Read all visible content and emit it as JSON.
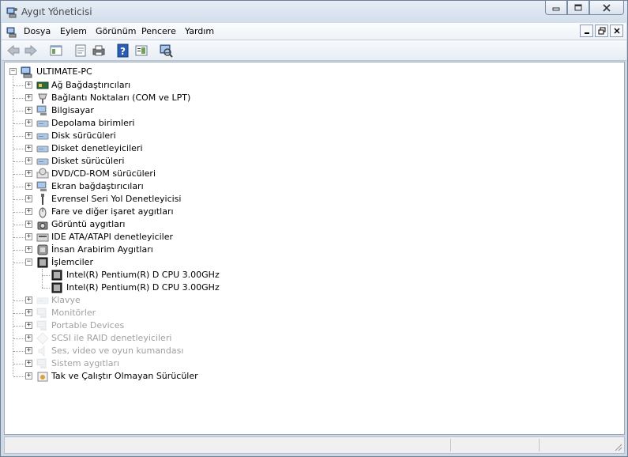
{
  "window": {
    "title": "Aygıt Yöneticisi"
  },
  "menu": [
    "Dosya",
    "Eylem",
    "Görünüm",
    "Pencere",
    "Yardım"
  ],
  "toolbar_icons": [
    "back-icon",
    "forward-icon",
    "show-hide-tree-icon",
    "properties-icon",
    "print-icon",
    "help-icon",
    "view-icon",
    "scan-hardware-icon"
  ],
  "tree": {
    "root": "ULTIMATE-PC",
    "categories": [
      {
        "label": "Ağ Bağdaştırıcıları",
        "icon": "network-adapter-icon",
        "dim": false
      },
      {
        "label": "Bağlantı Noktaları (COM ve LPT)",
        "icon": "port-icon",
        "dim": false
      },
      {
        "label": "Bilgisayar",
        "icon": "computer-icon",
        "dim": false
      },
      {
        "label": "Depolama birimleri",
        "icon": "storage-icon",
        "dim": false
      },
      {
        "label": "Disk sürücüleri",
        "icon": "disk-drive-icon",
        "dim": false
      },
      {
        "label": "Disket denetleyicileri",
        "icon": "floppy-controller-icon",
        "dim": false
      },
      {
        "label": "Disket sürücüleri",
        "icon": "floppy-drive-icon",
        "dim": false
      },
      {
        "label": "DVD/CD-ROM sürücüleri",
        "icon": "dvd-drive-icon",
        "dim": false
      },
      {
        "label": "Ekran bağdaştırıcıları",
        "icon": "display-adapter-icon",
        "dim": false
      },
      {
        "label": "Evrensel Seri Yol Denetleyicisi",
        "icon": "usb-icon",
        "dim": false
      },
      {
        "label": "Fare ve diğer işaret aygıtları",
        "icon": "mouse-icon",
        "dim": false
      },
      {
        "label": "Görüntü aygıtları",
        "icon": "imaging-device-icon",
        "dim": false
      },
      {
        "label": "IDE ATA/ATAPI denetleyiciler",
        "icon": "ide-controller-icon",
        "dim": false
      },
      {
        "label": "İnsan Arabirim Aygıtları",
        "icon": "hid-icon",
        "dim": false
      },
      {
        "label": "İşlemciler",
        "icon": "processor-icon",
        "dim": false,
        "expanded": true,
        "children": [
          "Intel(R) Pentium(R) D CPU 3.00GHz",
          "Intel(R) Pentium(R) D CPU 3.00GHz"
        ]
      },
      {
        "label": "Klavye",
        "icon": "keyboard-icon",
        "dim": true
      },
      {
        "label": "Monitörler",
        "icon": "monitor-icon",
        "dim": true
      },
      {
        "label": "Portable Devices",
        "icon": "portable-device-icon",
        "dim": true
      },
      {
        "label": "SCSI ile RAID denetleyicileri",
        "icon": "scsi-icon",
        "dim": true
      },
      {
        "label": "Ses, video ve oyun kumandası",
        "icon": "sound-icon",
        "dim": true
      },
      {
        "label": "Sistem aygıtları",
        "icon": "system-device-icon",
        "dim": true
      },
      {
        "label": "Tak ve Çalıştır Olmayan Sürücüler",
        "icon": "non-pnp-driver-icon",
        "dim": false
      }
    ]
  }
}
